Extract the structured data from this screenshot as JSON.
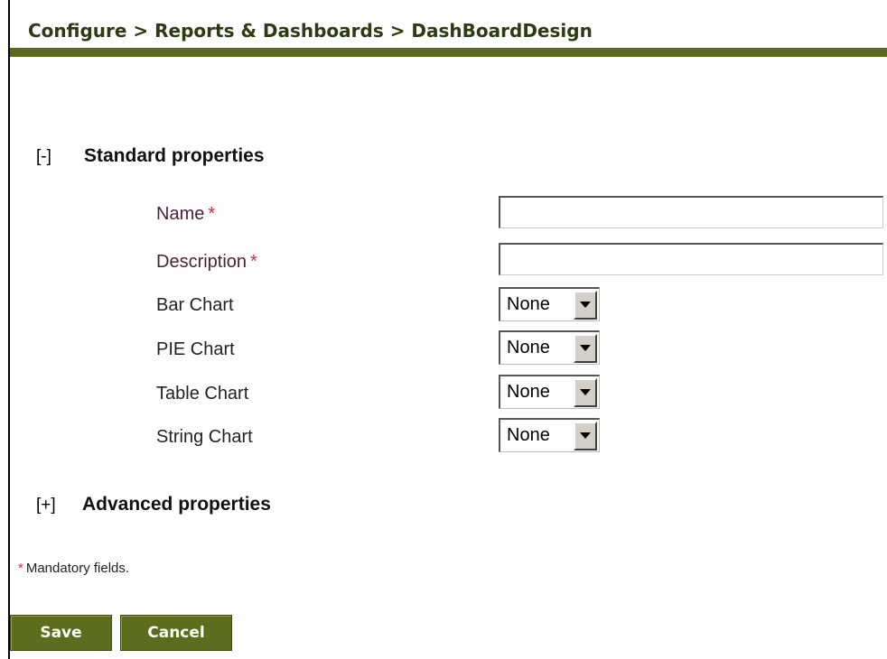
{
  "header": {
    "breadcrumb": "Configure > Reports & Dashboards > DashBoardDesign"
  },
  "standard_section": {
    "toggle": "[-]",
    "title": "Standard properties"
  },
  "fields": {
    "name": {
      "label": "Name",
      "required_mark": "*",
      "value": ""
    },
    "description": {
      "label": "Description",
      "required_mark": "*",
      "value": ""
    },
    "bar_chart": {
      "label": "Bar Chart",
      "selected": "None"
    },
    "pie_chart": {
      "label": "PIE Chart",
      "selected": "None"
    },
    "table_chart": {
      "label": "Table Chart",
      "selected": "None"
    },
    "string_chart": {
      "label": "String Chart",
      "selected": "None"
    }
  },
  "advanced_section": {
    "toggle": "[+]",
    "title": "Advanced properties"
  },
  "footer": {
    "mandatory_star": "*",
    "mandatory_note": "Mandatory fields."
  },
  "actions": {
    "save_label": "Save",
    "cancel_label": "Cancel"
  },
  "colors": {
    "header_bar": "#5a6a1c",
    "button_bg": "#5c6e1d",
    "required_mark": "#d0283a"
  }
}
